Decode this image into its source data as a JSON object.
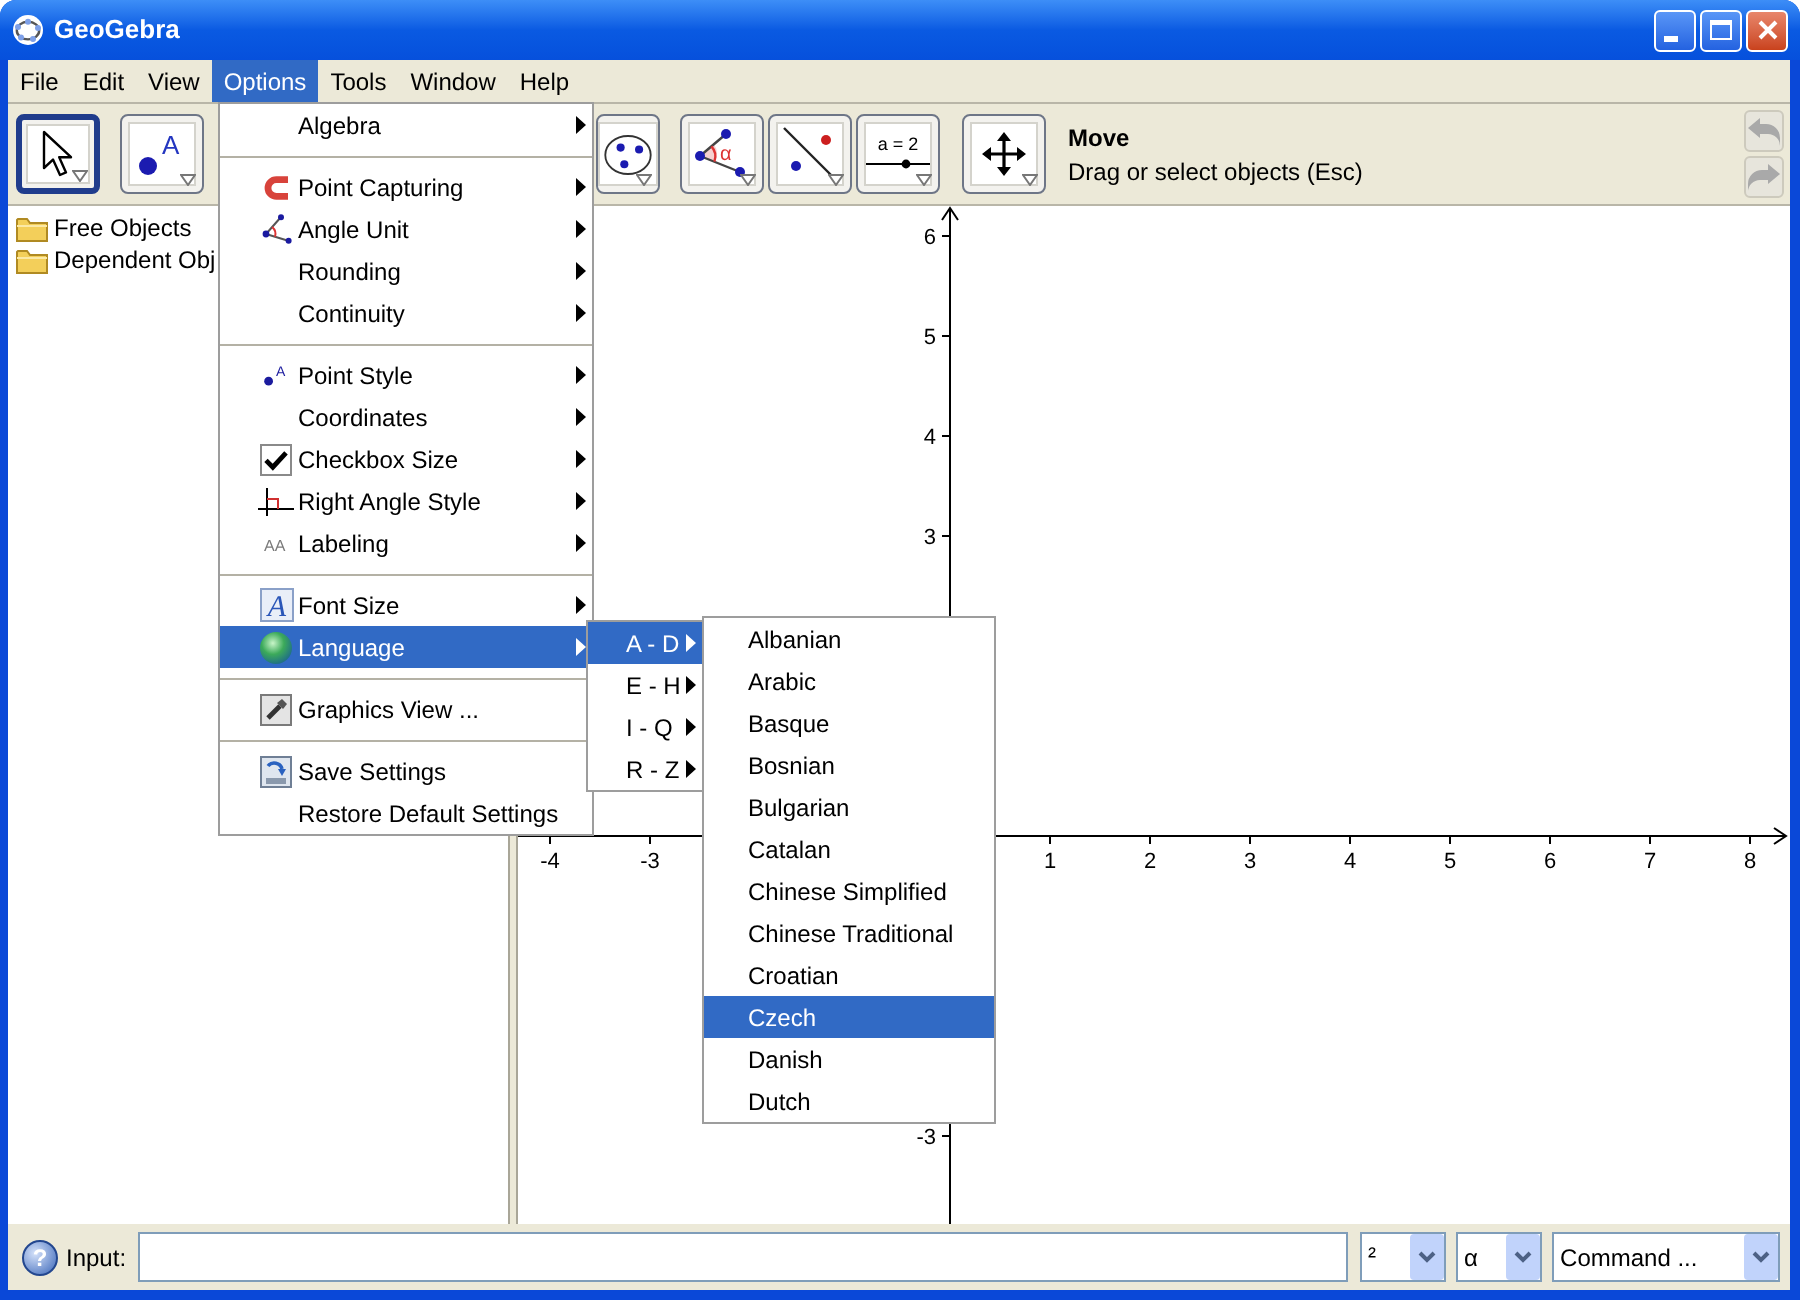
{
  "window": {
    "title": "GeoGebra"
  },
  "menu_bar": [
    {
      "label": "File",
      "selected": false
    },
    {
      "label": "Edit",
      "selected": false
    },
    {
      "label": "View",
      "selected": false
    },
    {
      "label": "Options",
      "selected": true
    },
    {
      "label": "Tools",
      "selected": false
    },
    {
      "label": "Window",
      "selected": false
    },
    {
      "label": "Help",
      "selected": false
    }
  ],
  "toolbar": {
    "tools": [
      {
        "kind": "move",
        "selected": true
      },
      {
        "kind": "point",
        "icon_text": "A",
        "selected": false
      },
      {
        "kind": "circle",
        "selected": false
      },
      {
        "kind": "angle",
        "icon_text": "α",
        "selected": false
      },
      {
        "kind": "line",
        "selected": false
      },
      {
        "kind": "slider",
        "icon_text": "a = 2",
        "selected": false
      },
      {
        "kind": "pan",
        "selected": false
      }
    ],
    "tool_name": "Move",
    "tool_help": "Drag or select objects (Esc)",
    "history_buttons": [
      {
        "kind": "undo",
        "disabled": true
      },
      {
        "kind": "redo",
        "disabled": true
      }
    ]
  },
  "algebra_view": {
    "folders": [
      "Free Objects",
      "Dependent Obj"
    ]
  },
  "graphics_view": {
    "x_axis": {
      "negative_labels": [
        "-4",
        "-3"
      ],
      "positive_labels": [
        "1",
        "2",
        "3",
        "4",
        "5",
        "6",
        "7",
        "8"
      ]
    },
    "y_axis": {
      "positive_labels": [
        "6",
        "5",
        "4",
        "3"
      ],
      "negative_labels": [
        "-3"
      ]
    }
  },
  "options_menu": {
    "groups": [
      {
        "items": [
          {
            "label": "Algebra",
            "kind": "plain",
            "submenu": true,
            "selected": false
          }
        ]
      },
      {
        "items": [
          {
            "label": "Point Capturing",
            "kind": "capturing",
            "submenu": true,
            "selected": false
          },
          {
            "label": "Angle Unit",
            "kind": "angle",
            "submenu": true,
            "selected": false
          },
          {
            "label": "Rounding",
            "kind": "plain",
            "submenu": true,
            "selected": false
          },
          {
            "label": "Continuity",
            "kind": "plain",
            "submenu": true,
            "selected": false
          }
        ]
      },
      {
        "items": [
          {
            "label": "Point Style",
            "kind": "pointstyle",
            "icon_text": "A",
            "submenu": true,
            "selected": false
          },
          {
            "label": "Coordinates",
            "kind": "plain",
            "submenu": true,
            "selected": false
          },
          {
            "label": "Checkbox Size",
            "kind": "checkbox",
            "submenu": true,
            "selected": false
          },
          {
            "label": "Right Angle Style",
            "kind": "rightangle",
            "submenu": true,
            "selected": false
          },
          {
            "label": "Labeling",
            "kind": "labeling",
            "icon_text": "AA",
            "submenu": true,
            "selected": false
          }
        ]
      },
      {
        "items": [
          {
            "label": "Font Size",
            "kind": "font",
            "icon_text": "A",
            "submenu": true,
            "selected": false
          },
          {
            "label": "Language",
            "kind": "language",
            "submenu": true,
            "selected": true
          }
        ]
      },
      {
        "items": [
          {
            "label": "Graphics View ...",
            "kind": "graphics",
            "submenu": false,
            "selected": false
          }
        ]
      },
      {
        "items": [
          {
            "label": "Save Settings",
            "kind": "save",
            "submenu": false,
            "selected": false
          },
          {
            "label": "Restore Default Settings",
            "kind": "plain",
            "submenu": false,
            "selected": false
          }
        ]
      }
    ]
  },
  "language_submenu": [
    {
      "label": "A - D",
      "selected": true
    },
    {
      "label": "E - H",
      "selected": false
    },
    {
      "label": "I - Q",
      "selected": false
    },
    {
      "label": "R - Z",
      "selected": false
    }
  ],
  "language_list": [
    {
      "label": "Albanian",
      "selected": false
    },
    {
      "label": "Arabic",
      "selected": false
    },
    {
      "label": "Basque",
      "selected": false
    },
    {
      "label": "Bosnian",
      "selected": false
    },
    {
      "label": "Bulgarian",
      "selected": false
    },
    {
      "label": "Catalan",
      "selected": false
    },
    {
      "label": "Chinese Simplified",
      "selected": false
    },
    {
      "label": "Chinese Traditional",
      "selected": false
    },
    {
      "label": "Croatian",
      "selected": false
    },
    {
      "label": "Czech",
      "selected": true
    },
    {
      "label": "Danish",
      "selected": false
    },
    {
      "label": "Dutch",
      "selected": false
    }
  ],
  "input_bar": {
    "help_symbol": "?",
    "label": "Input:",
    "symbol_menu": "²",
    "greek_menu": "α",
    "command_menu": "Command ..."
  }
}
